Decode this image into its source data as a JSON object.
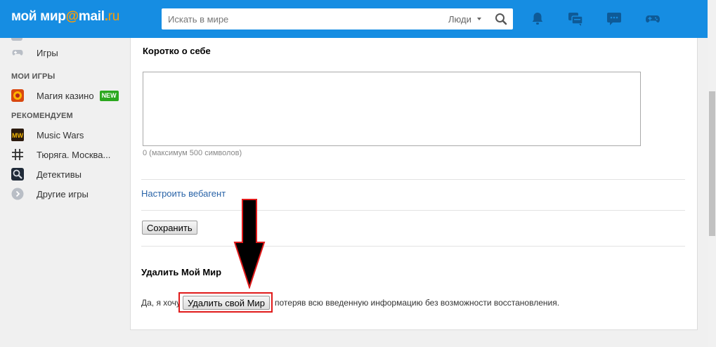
{
  "header": {
    "logo_main": "мой мир",
    "logo_at": "@",
    "logo_mail": "mail",
    "logo_dot": ".",
    "logo_ru": "ru",
    "search": {
      "placeholder": "Искать в мире",
      "scope": "Люди"
    },
    "icons": [
      "bell-icon",
      "messages-icon",
      "chat-icon",
      "gamepad-icon"
    ],
    "accent_color": "#168de2"
  },
  "sidebar": {
    "games_item": {
      "label": "Игры",
      "icon": "gamepad-icon"
    },
    "my_games_heading": "МОИ ИГРЫ",
    "my_games": [
      {
        "label": "Магия казино",
        "badge": "NEW",
        "icon": "casino-game-icon"
      }
    ],
    "recommended_heading": "РЕКОМЕНДУЕМ",
    "recommended": [
      {
        "label": "Music Wars",
        "icon": "music-wars-icon",
        "icon_text": "MW"
      },
      {
        "label": "Тюряга. Москва...",
        "icon": "hash-icon"
      },
      {
        "label": "Детективы",
        "icon": "magnifier-game-icon"
      },
      {
        "label": "Другие игры",
        "icon": "chevron-right-icon"
      }
    ]
  },
  "main": {
    "about": {
      "title": "Коротко о себе",
      "value": "",
      "counter": "0 (максимум 500 символов)"
    },
    "webagent_link": "Настроить вебагент",
    "save_button": "Сохранить",
    "delete": {
      "title": "Удалить Мой Мир",
      "prefix": "Да, я хочу",
      "button": "Удалить свой Мир",
      "suffix": "потеряв всю введенную информацию без возможности восстановления."
    }
  },
  "annotation": {
    "highlight_color": "#e01b1b",
    "arrow_color": "#000000"
  }
}
